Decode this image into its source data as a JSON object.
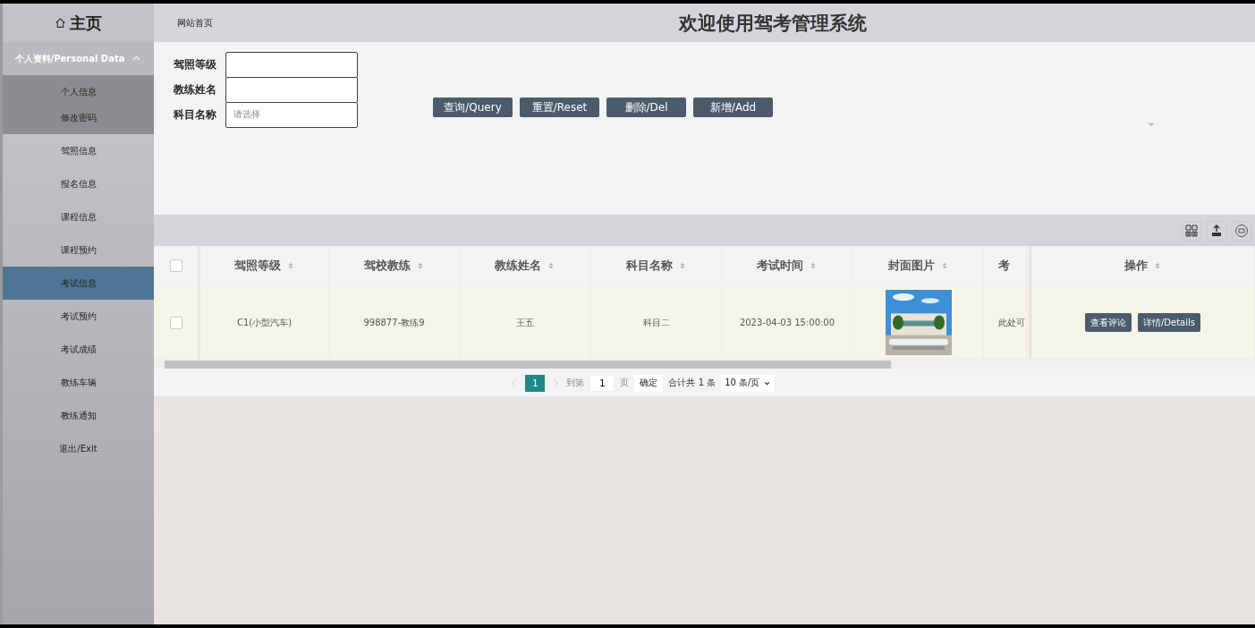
{
  "sidebar": {
    "home": "主页",
    "group": {
      "label": "个人资料/Personal Data",
      "expanded": true,
      "children": [
        {
          "label": "个人信息",
          "selected": false
        },
        {
          "label": "修改密码",
          "selected": false
        }
      ]
    },
    "items": [
      {
        "label": "驾照信息",
        "selected": false
      },
      {
        "label": "报名信息",
        "selected": false
      },
      {
        "label": "课程信息",
        "selected": false
      },
      {
        "label": "课程预约",
        "selected": false
      },
      {
        "label": "考试信息",
        "selected": true
      },
      {
        "label": "考试预约",
        "selected": false
      },
      {
        "label": "考试成绩",
        "selected": false
      },
      {
        "label": "教练车辆",
        "selected": false
      },
      {
        "label": "教练通知",
        "selected": false
      },
      {
        "label": "退出/Exit",
        "selected": false
      }
    ]
  },
  "header": {
    "breadcrumb": "网站首页",
    "title": "欢迎使用驾考管理系统"
  },
  "search": {
    "fields": [
      {
        "label": "驾照等级",
        "kind": "input"
      },
      {
        "label": "教练姓名",
        "kind": "input"
      },
      {
        "label": "科目名称",
        "kind": "select",
        "placeholder": "请选择"
      }
    ],
    "buttons": [
      "查询/Query",
      "重置/Reset",
      "删除/Del",
      "新增/Add"
    ]
  },
  "table": {
    "columns": [
      "驾照等级",
      "驾校教练",
      "教练姓名",
      "科目名称",
      "考试时间",
      "封面图片",
      "考"
    ],
    "action_column": "操作",
    "all_selected": false,
    "rows": [
      {
        "selected": false,
        "cells": [
          {
            "kind": "text",
            "text": "C1(小型汽车)"
          },
          {
            "kind": "text",
            "text": "998877-教练9"
          },
          {
            "kind": "text",
            "text": "王五"
          },
          {
            "kind": "text",
            "text": "科目二"
          },
          {
            "kind": "text",
            "text": "2023-04-03 15:00:00"
          },
          {
            "kind": "picture"
          },
          {
            "kind": "text",
            "text": "此处可"
          }
        ],
        "actions": [
          "查看评论",
          "详情/Details"
        ]
      }
    ]
  },
  "pagination": {
    "pages": [
      {
        "label": "1",
        "selected": true
      }
    ],
    "goto_label": "到第",
    "goto_value": "1",
    "page_unit": "页",
    "confirm": "确定",
    "total": "合计共 1 条",
    "page_size": "10 条/页"
  }
}
